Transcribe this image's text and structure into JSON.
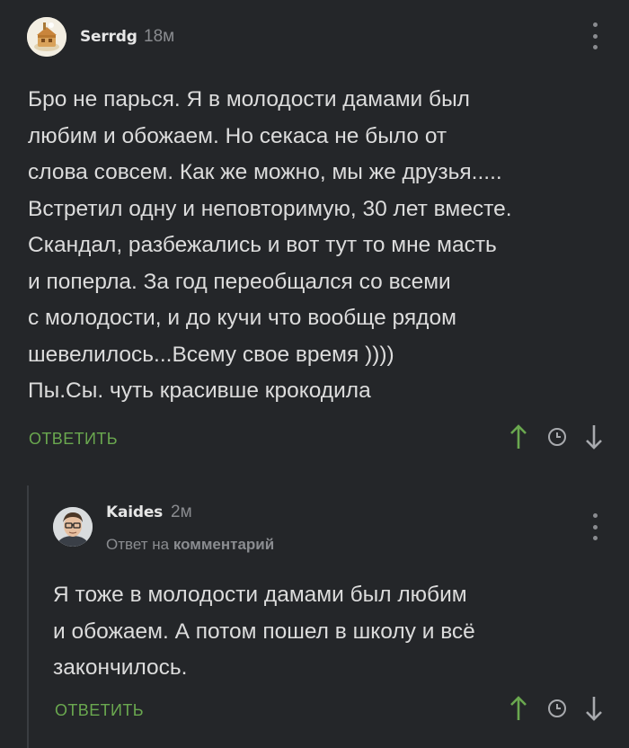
{
  "comments": [
    {
      "author": "Serrdg",
      "time": "18м",
      "text": "Бро не парься. Я в молодости дамами был\nлюбим и обожаем. Но секаса не было от\nслова совсем. Как же можно, мы же друзья.....\nВстретил одну и неповторимую, 30 лет вместе.\nСкандал, разбежались и вот тут то мне масть\nи поперла. За год переобщался со всеми\nс молодости, и до кучи что вообще рядом\nшевелилось...Всему свое время ))))\nПы.Сы. чуть красивше крокодила",
      "reply_label": "ОТВЕТИТЬ"
    },
    {
      "author": "Kaides",
      "time": "2м",
      "reply_to_prefix": "Ответ на",
      "reply_to_target": "комментарий",
      "text": "Я тоже в молодости дамами был любим\nи обожаем. А потом пошел в школу и всё\nзакончилось.",
      "reply_label": "ОТВЕТИТЬ"
    }
  ],
  "icons": {
    "upvote": "arrow-up-icon",
    "history": "clock-icon",
    "downvote": "arrow-down-icon",
    "menu": "more-vertical-icon"
  },
  "colors": {
    "background": "#242629",
    "text": "#dcdcdc",
    "muted": "#8a8c90",
    "accent": "#6aa84f"
  }
}
